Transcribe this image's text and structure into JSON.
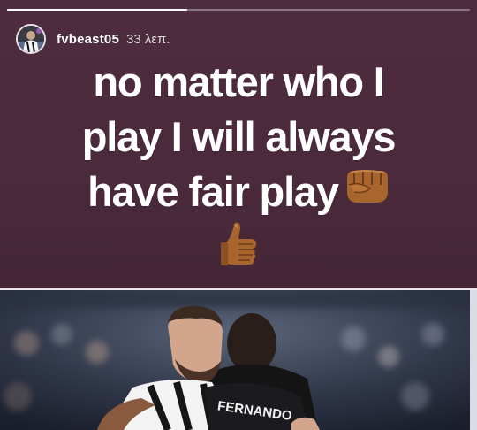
{
  "story": {
    "progress_fraction": 0.39,
    "username": "fvbeast05",
    "time_ago": "33 λεπ.",
    "caption_lines": [
      "no matter who I",
      "play I will always",
      "have fair play"
    ],
    "emojis": [
      "fist-emoji",
      "thumbs-up-emoji"
    ],
    "photo_jersey_text": "FERNANDO"
  },
  "colors": {
    "story_background": "#4b2a3c",
    "text": "#ffffff",
    "emoji_skin": "#a8652e"
  }
}
